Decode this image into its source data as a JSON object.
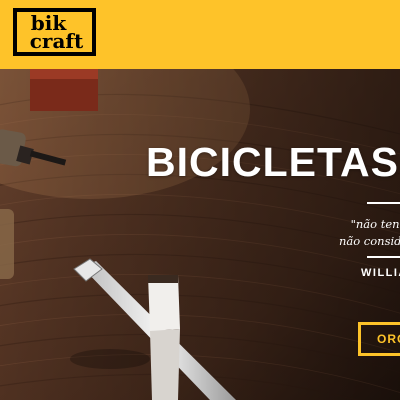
{
  "brand": {
    "logo_line1": "bik",
    "logo_line2": "craft",
    "accent_color": "#FEC329"
  },
  "hero": {
    "title": "BICICLETAS",
    "quote_line1": "\"não tenha nado",
    "quote_line2": "não considere úti",
    "author": "WILLIA",
    "cta_label": "ORÇ",
    "background_image": "wooden-table-with-tools-photo"
  }
}
